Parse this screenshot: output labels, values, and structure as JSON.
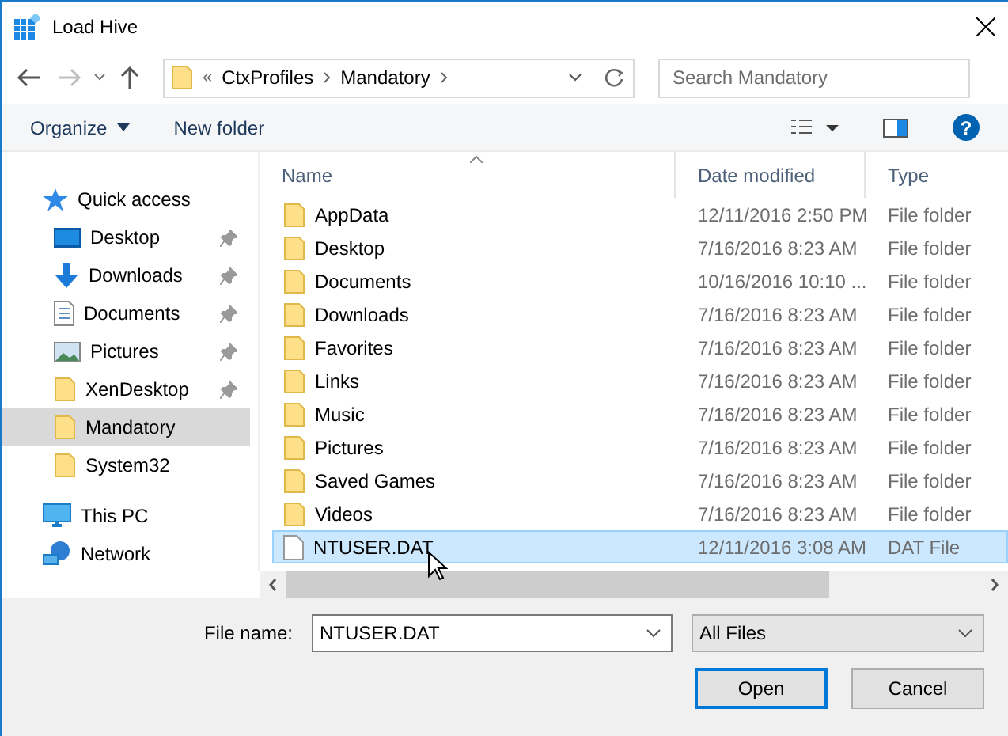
{
  "window": {
    "title": "Load Hive"
  },
  "address": {
    "overflow": "«",
    "crumbs": [
      "CtxProfiles",
      "Mandatory"
    ]
  },
  "search": {
    "placeholder": "Search Mandatory"
  },
  "toolbar": {
    "organize": "Organize",
    "new_folder": "New folder",
    "help": "?"
  },
  "sidebar": [
    {
      "label": "Quick access",
      "kind": "star",
      "selected": false,
      "children": [
        {
          "label": "Desktop",
          "kind": "desktop",
          "pinned": true,
          "selected": false
        },
        {
          "label": "Downloads",
          "kind": "download",
          "pinned": true,
          "selected": false
        },
        {
          "label": "Documents",
          "kind": "document",
          "pinned": true,
          "selected": false
        },
        {
          "label": "Pictures",
          "kind": "pictures",
          "pinned": true,
          "selected": false
        },
        {
          "label": "XenDesktop",
          "kind": "folder",
          "pinned": true,
          "selected": false
        },
        {
          "label": "Mandatory",
          "kind": "folder",
          "pinned": false,
          "selected": true
        },
        {
          "label": "System32",
          "kind": "folder",
          "pinned": false,
          "selected": false
        }
      ]
    },
    {
      "label": "This PC",
      "kind": "pc",
      "selected": false
    },
    {
      "label": "Network",
      "kind": "network",
      "selected": false
    }
  ],
  "columns": [
    "Name",
    "Date modified",
    "Type"
  ],
  "files": [
    {
      "name": "AppData",
      "date": "12/11/2016 2:50 PM",
      "type": "File folder",
      "kind": "folder",
      "selected": false
    },
    {
      "name": "Desktop",
      "date": "7/16/2016 8:23 AM",
      "type": "File folder",
      "kind": "folder",
      "selected": false
    },
    {
      "name": "Documents",
      "date": "10/16/2016 10:10 ...",
      "type": "File folder",
      "kind": "folder",
      "selected": false
    },
    {
      "name": "Downloads",
      "date": "7/16/2016 8:23 AM",
      "type": "File folder",
      "kind": "folder",
      "selected": false
    },
    {
      "name": "Favorites",
      "date": "7/16/2016 8:23 AM",
      "type": "File folder",
      "kind": "folder",
      "selected": false
    },
    {
      "name": "Links",
      "date": "7/16/2016 8:23 AM",
      "type": "File folder",
      "kind": "folder",
      "selected": false
    },
    {
      "name": "Music",
      "date": "7/16/2016 8:23 AM",
      "type": "File folder",
      "kind": "folder",
      "selected": false
    },
    {
      "name": "Pictures",
      "date": "7/16/2016 8:23 AM",
      "type": "File folder",
      "kind": "folder",
      "selected": false
    },
    {
      "name": "Saved Games",
      "date": "7/16/2016 8:23 AM",
      "type": "File folder",
      "kind": "folder",
      "selected": false
    },
    {
      "name": "Videos",
      "date": "7/16/2016 8:23 AM",
      "type": "File folder",
      "kind": "folder",
      "selected": false
    },
    {
      "name": "NTUSER.DAT",
      "date": "12/11/2016 3:08 AM",
      "type": "DAT File",
      "kind": "file",
      "selected": true
    }
  ],
  "filename": {
    "label": "File name:",
    "value": "NTUSER.DAT"
  },
  "filter": {
    "value": "All Files"
  },
  "buttons": [
    "Open",
    "Cancel"
  ]
}
